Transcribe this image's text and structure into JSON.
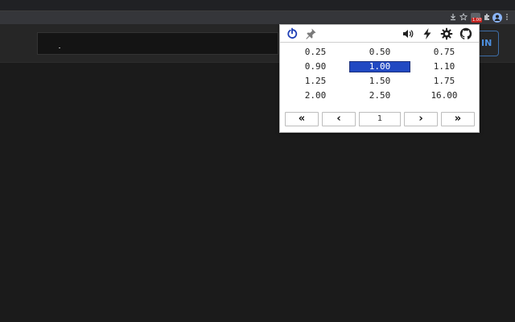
{
  "toolbar": {
    "icons": [
      "download-icon",
      "star-icon",
      "extension-speed-icon",
      "puzzle-icon",
      "profile-avatar",
      "menu-dots-icon"
    ],
    "extension_badge": "1.00"
  },
  "page": {
    "signin_label": "IN"
  },
  "popup": {
    "toolbar_icons": [
      "power-icon",
      "pin-icon",
      "volume-icon",
      "lightning-icon",
      "gear-icon",
      "github-icon"
    ],
    "accent_color": "#2149c2",
    "speeds": [
      "0.25",
      "0.50",
      "0.75",
      "0.90",
      "1.00",
      "1.10",
      "1.25",
      "1.50",
      "1.75",
      "2.00",
      "2.50",
      "16.00"
    ],
    "selected_speed": "1.00",
    "pager": {
      "first": "«",
      "prev": "‹",
      "page": "1",
      "next": "›",
      "last": "»"
    }
  }
}
